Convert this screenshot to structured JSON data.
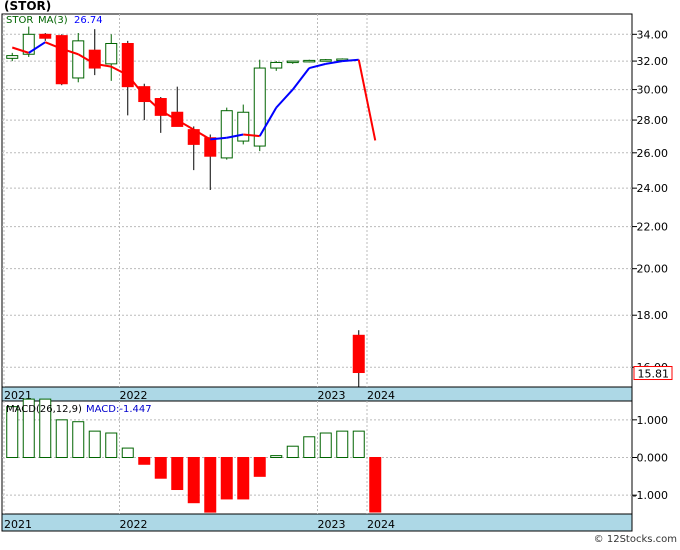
{
  "title": "(STOR)",
  "footer": "© 12Stocks.com",
  "colors": {
    "up": "#006400",
    "down": "#ff0000",
    "ma_up": "#0000ff",
    "ma_down": "#ff0000",
    "band": "#add8e6",
    "grid": "#bbbbbb",
    "last_price_label": "#ff0000"
  },
  "chart_data": [
    {
      "type": "candlestick",
      "panel": "price",
      "legend": {
        "symbol": "STOR",
        "ma_label": "MA(3)",
        "ma_value": "26.74"
      },
      "yscale": "log",
      "ylim": [
        15.3,
        35.6
      ],
      "y_ticks": [
        16,
        18,
        20,
        22,
        24,
        26,
        28,
        30,
        32,
        34
      ],
      "y_tick_labels": [
        "16.00",
        "18.00",
        "20.00",
        "22.00",
        "24.00",
        "26.00",
        "28.00",
        "30.00",
        "32.00",
        "34.00"
      ],
      "last_price": "15.81",
      "x_ticks": [
        {
          "label": "2021",
          "index": -0.5
        },
        {
          "label": "2022",
          "index": 6.5
        },
        {
          "label": "2023",
          "index": 18.5
        },
        {
          "label": "2024",
          "index": 21.5
        }
      ],
      "candles": [
        {
          "o": 32.2,
          "h": 32.6,
          "l": 32.0,
          "c": 32.4
        },
        {
          "o": 32.5,
          "h": 34.6,
          "l": 32.3,
          "c": 34.0
        },
        {
          "o": 34.0,
          "h": 34.1,
          "l": 33.5,
          "c": 33.7
        },
        {
          "o": 33.9,
          "h": 34.0,
          "l": 30.3,
          "c": 30.4
        },
        {
          "o": 30.8,
          "h": 34.1,
          "l": 30.5,
          "c": 33.5
        },
        {
          "o": 32.8,
          "h": 34.4,
          "l": 31.0,
          "c": 31.5
        },
        {
          "o": 31.8,
          "h": 34.0,
          "l": 30.6,
          "c": 33.3
        },
        {
          "o": 33.3,
          "h": 33.5,
          "l": 28.3,
          "c": 30.2
        },
        {
          "o": 30.2,
          "h": 30.4,
          "l": 28.0,
          "c": 29.2
        },
        {
          "o": 29.4,
          "h": 29.5,
          "l": 27.2,
          "c": 28.3
        },
        {
          "o": 28.5,
          "h": 30.2,
          "l": 27.7,
          "c": 27.6
        },
        {
          "o": 27.4,
          "h": 27.6,
          "l": 25.0,
          "c": 26.5
        },
        {
          "o": 26.9,
          "h": 27.1,
          "l": 23.9,
          "c": 25.8
        },
        {
          "o": 25.7,
          "h": 28.8,
          "l": 25.6,
          "c": 28.6
        },
        {
          "o": 26.7,
          "h": 29.0,
          "l": 26.5,
          "c": 28.5
        },
        {
          "o": 26.4,
          "h": 32.1,
          "l": 26.1,
          "c": 31.5
        },
        {
          "o": 31.5,
          "h": 32.0,
          "l": 31.3,
          "c": 31.9
        },
        {
          "o": 31.9,
          "h": 32.0,
          "l": 31.8,
          "c": 32.0
        },
        {
          "o": 32.0,
          "h": 32.1,
          "l": 31.9,
          "c": 32.05
        },
        {
          "o": 32.05,
          "h": 32.15,
          "l": 32.0,
          "c": 32.1
        },
        {
          "o": 32.1,
          "h": 32.2,
          "l": 32.05,
          "c": 32.15
        },
        {
          "o": 17.2,
          "h": 17.4,
          "l": 15.3,
          "c": 15.81
        }
      ],
      "ma": [
        33.0,
        32.6,
        33.4,
        32.9,
        32.5,
        31.8,
        31.6,
        31.0,
        29.6,
        28.6,
        28.0,
        27.4,
        26.8,
        26.9,
        27.1,
        27.0,
        28.8,
        30.0,
        31.5,
        31.8,
        32.0,
        32.1,
        26.74
      ]
    },
    {
      "type": "bar",
      "panel": "macd",
      "legend": {
        "label": "MACD(26,12,9)",
        "value_label": "MACD:-1.447"
      },
      "ylim": [
        -1.5,
        1.5
      ],
      "y_ticks": [
        1.0,
        0.0,
        -1.0
      ],
      "y_tick_labels": [
        "1.000",
        "0.000",
        "-1.000"
      ],
      "x_ticks": [
        {
          "label": "2021",
          "index": -0.5
        },
        {
          "label": "2022",
          "index": 6.5
        },
        {
          "label": "2023",
          "index": 18.5
        },
        {
          "label": "2024",
          "index": 21.5
        }
      ],
      "values": [
        1.35,
        1.55,
        1.55,
        1.0,
        0.95,
        0.7,
        0.65,
        0.25,
        -0.18,
        -0.55,
        -0.85,
        -1.2,
        -1.45,
        -1.1,
        -1.1,
        -0.5,
        0.05,
        0.3,
        0.55,
        0.65,
        0.7,
        0.7,
        -1.447
      ]
    }
  ]
}
